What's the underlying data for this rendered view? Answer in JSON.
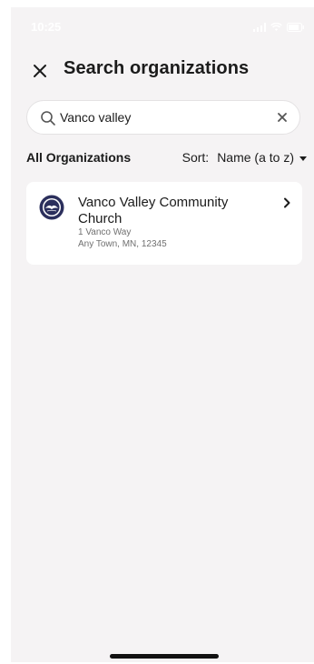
{
  "status_bar": {
    "time": "10:25"
  },
  "header": {
    "title": "Search organizations",
    "close_icon": "close-icon"
  },
  "search": {
    "value": "Vanco valley",
    "icon": "search-icon",
    "clear_icon": "clear-icon"
  },
  "filters": {
    "all_label": "All Organizations",
    "sort_label": "Sort:",
    "sort_value": "Name (a to z)"
  },
  "results": [
    {
      "name": "Vanco Valley Community Church",
      "address_line1": "1 Vanco Way",
      "address_line2": "Any Town, MN, 12345",
      "logo_icon": "church-logo-icon",
      "chevron_icon": "chevron-right-icon"
    }
  ],
  "colors": {
    "background": "#f5f3f4",
    "card": "#ffffff",
    "text": "#1b1b1b",
    "secondary_text": "#707070",
    "logo_navy": "#2b2f5c"
  }
}
